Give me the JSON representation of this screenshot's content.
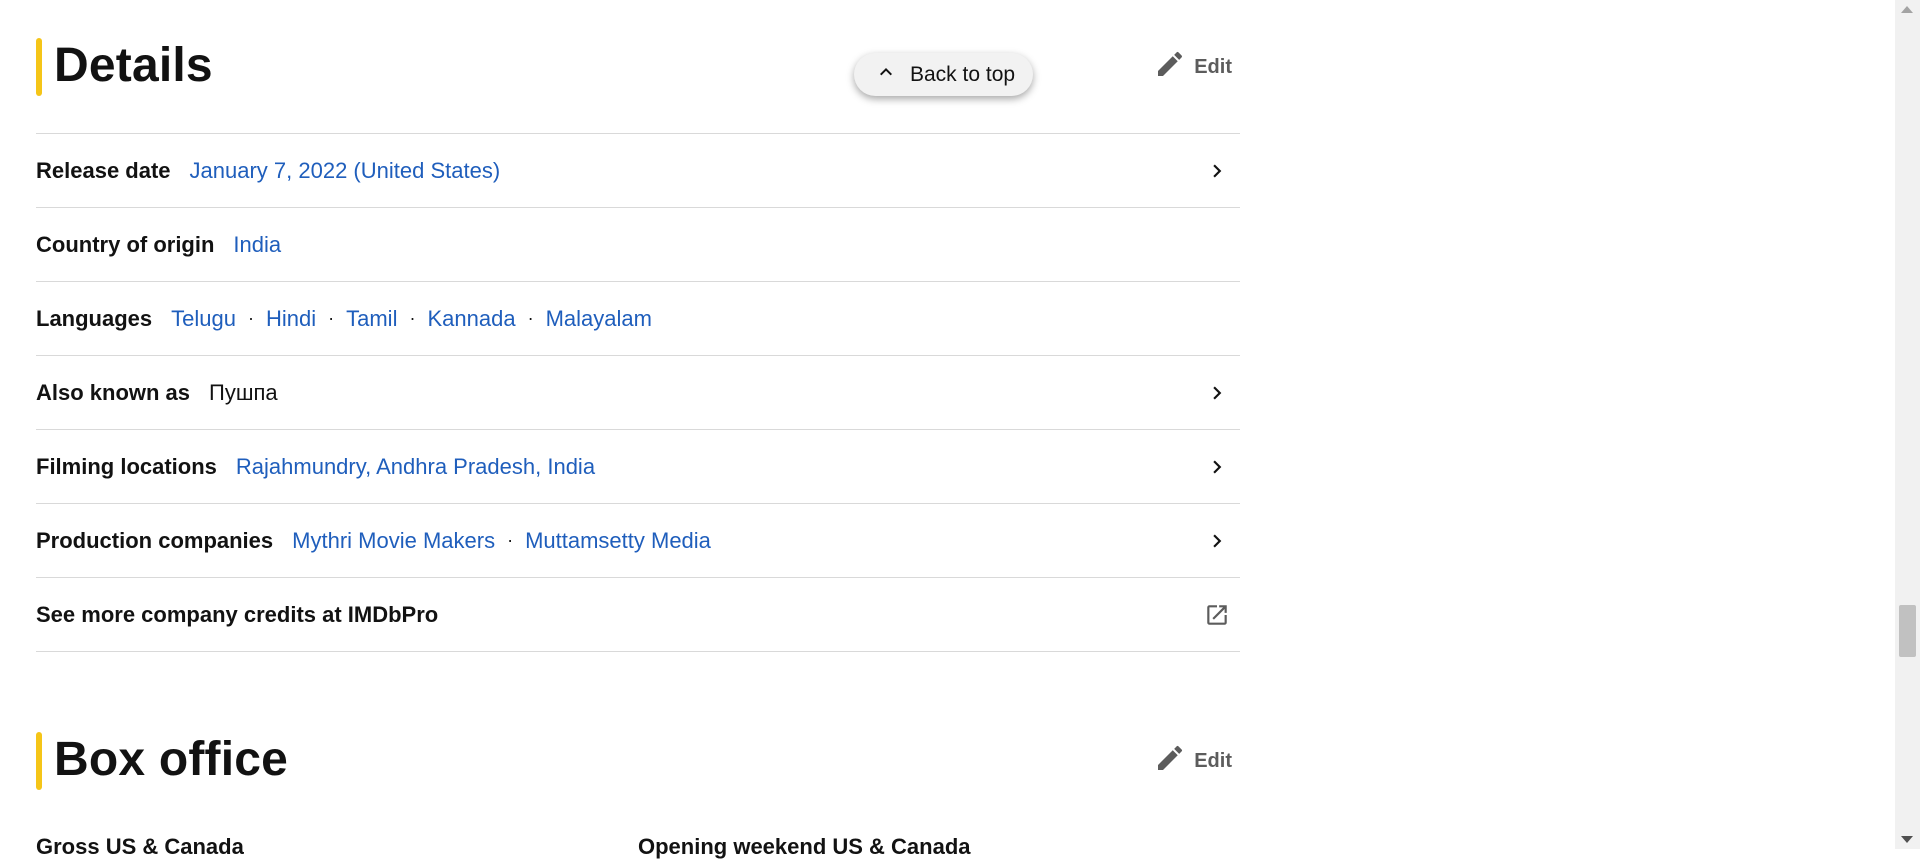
{
  "back_to_top": {
    "label": "Back to top"
  },
  "details": {
    "title": "Details",
    "edit_label": "Edit",
    "rows": [
      {
        "label": "Release date",
        "values": [
          "January 7, 2022 (United States)"
        ],
        "has_chevron": true
      },
      {
        "label": "Country of origin",
        "values": [
          "India"
        ],
        "has_chevron": false
      },
      {
        "label": "Languages",
        "values": [
          "Telugu",
          "Hindi",
          "Tamil",
          "Kannada",
          "Malayalam"
        ],
        "has_chevron": false
      },
      {
        "label": "Also known as",
        "values": [
          "Пушпа"
        ],
        "plain": true,
        "has_chevron": true
      },
      {
        "label": "Filming locations",
        "values": [
          "Rajahmundry, Andhra Pradesh, India"
        ],
        "has_chevron": true
      },
      {
        "label": "Production companies",
        "values": [
          "Mythri Movie Makers",
          "Muttamsetty Media"
        ],
        "has_chevron": true
      },
      {
        "label": "See more company credits at IMDbPro",
        "values": [],
        "has_external": true
      }
    ]
  },
  "box_office": {
    "title": "Box office",
    "edit_label": "Edit",
    "gross_label": "Gross US & Canada",
    "opening_label": "Opening weekend US & Canada"
  },
  "icons": {
    "edit": "pencil-icon",
    "back_to_top": "chevron-up-icon",
    "row_chevron": "chevron-right-icon",
    "external": "external-link-icon"
  },
  "colors": {
    "accent": "#f5c518",
    "link": "#1f5ebc",
    "text": "#121212",
    "divider": "#d9d9d9"
  }
}
